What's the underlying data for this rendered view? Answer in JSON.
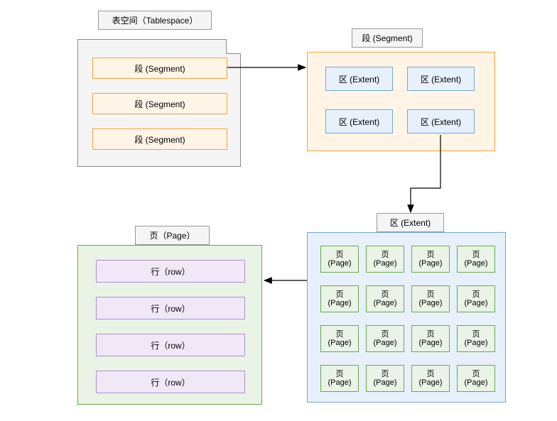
{
  "tablespace": {
    "title": "表空间（Tablespace）",
    "items": [
      "段 (Segment)",
      "段 (Segment)",
      "段 (Segment)"
    ]
  },
  "segment": {
    "title": "段 (Segment)",
    "items": [
      "区 (Extent)",
      "区 (Extent)",
      "区 (Extent)",
      "区 (Extent)"
    ]
  },
  "extent": {
    "title": "区 (Extent)",
    "page_line1": "页",
    "page_line2": "(Page)"
  },
  "page": {
    "title": "页（Page）",
    "items": [
      "行（row）",
      "行（row）",
      "行（row）",
      "行（row）"
    ]
  }
}
